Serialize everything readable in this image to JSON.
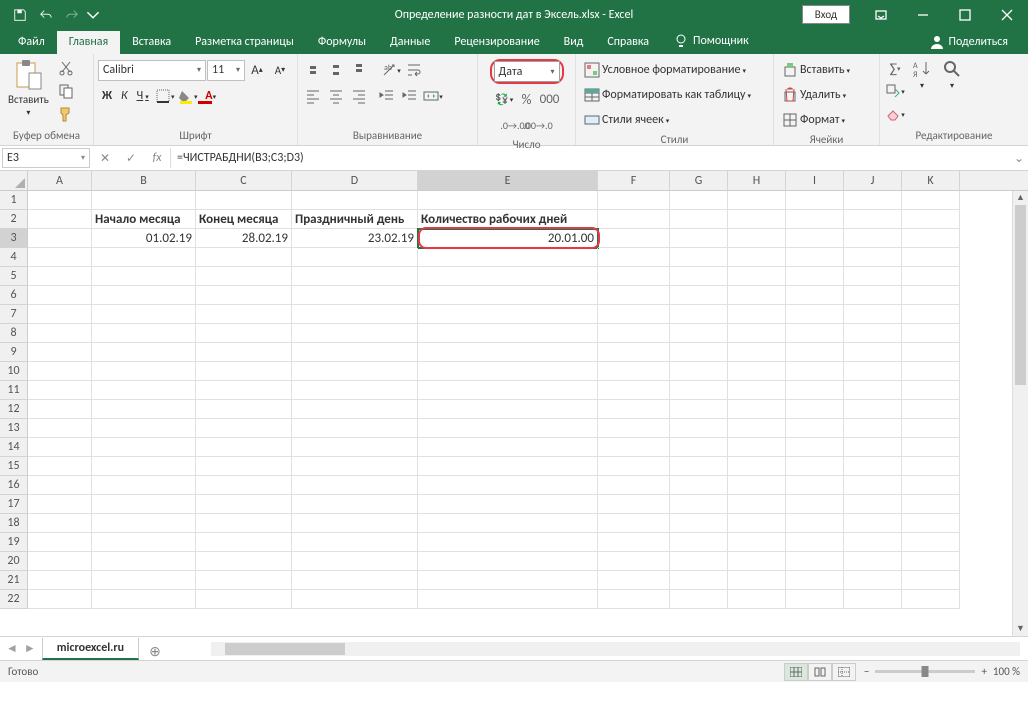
{
  "titlebar": {
    "doc_title": "Определение разности дат в Эксель.xlsx  -  Excel",
    "login": "Вход"
  },
  "tabs": {
    "file": "Файл",
    "home": "Главная",
    "insert": "Вставка",
    "page_layout": "Разметка страницы",
    "formulas": "Формулы",
    "data": "Данные",
    "review": "Рецензирование",
    "view": "Вид",
    "help": "Справка",
    "tell_me": "Помощник",
    "share": "Поделиться"
  },
  "ribbon": {
    "clipboard": {
      "label": "Буфер обмена",
      "paste": "Вставить"
    },
    "font": {
      "label": "Шрифт",
      "name": "Calibri",
      "size": "11",
      "bold": "Ж",
      "italic": "К",
      "underline": "Ч"
    },
    "alignment": {
      "label": "Выравнивание"
    },
    "number": {
      "label": "Число",
      "format": "Дата"
    },
    "styles": {
      "label": "Стили",
      "cond": "Условное форматирование",
      "table": "Форматировать как таблицу",
      "cell": "Стили ячеек"
    },
    "cells": {
      "label": "Ячейки",
      "insert": "Вставить",
      "delete": "Удалить",
      "format": "Формат"
    },
    "editing": {
      "label": "Редактирование"
    }
  },
  "formula_bar": {
    "name_box": "E3",
    "formula": "=ЧИСТРАБДНИ(B3;C3;D3)"
  },
  "columns": [
    "A",
    "B",
    "C",
    "D",
    "E",
    "F",
    "G",
    "H",
    "I",
    "J",
    "K"
  ],
  "row_headers": [
    1,
    2,
    3,
    4,
    5,
    6,
    7,
    8,
    9,
    10,
    11,
    12,
    13,
    14,
    15,
    16,
    17,
    18,
    19,
    20,
    21,
    22
  ],
  "data": {
    "r2": {
      "B": "Начало месяца",
      "C": "Конец месяца",
      "D": "Праздничный день",
      "E": "Количество рабочих дней"
    },
    "r3": {
      "B": "01.02.19",
      "C": "28.02.19",
      "D": "23.02.19",
      "E": "20.01.00"
    }
  },
  "sheet": {
    "name": "microexcel.ru"
  },
  "status": {
    "ready": "Готово",
    "zoom": "100 %"
  }
}
